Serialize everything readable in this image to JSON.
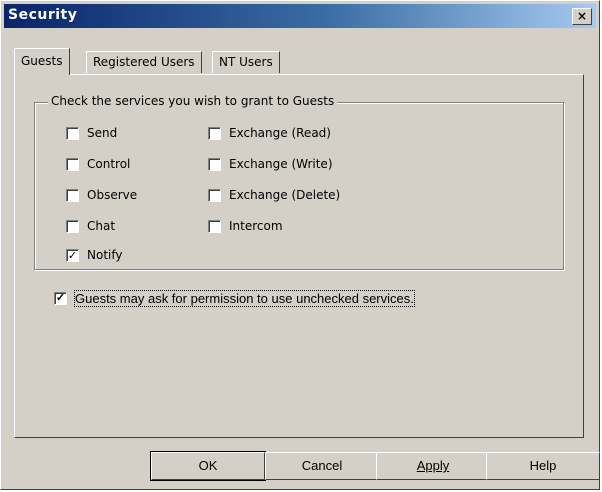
{
  "window": {
    "title": "Security",
    "close_glyph": "×"
  },
  "tabs": [
    {
      "label": "Guests"
    },
    {
      "label": "Registered Users"
    },
    {
      "label": "NT Users"
    }
  ],
  "group": {
    "legend": "Check the services you wish to grant to Guests"
  },
  "services": {
    "left": [
      {
        "label": "Send",
        "checked": false
      },
      {
        "label": "Control",
        "checked": false
      },
      {
        "label": "Observe",
        "checked": false
      },
      {
        "label": "Chat",
        "checked": false
      },
      {
        "label": "Notify",
        "checked": true
      }
    ],
    "right": [
      {
        "label": "Exchange (Read)",
        "checked": false
      },
      {
        "label": "Exchange (Write)",
        "checked": false
      },
      {
        "label": "Exchange (Delete)",
        "checked": false
      },
      {
        "label": "Intercom",
        "checked": false
      }
    ]
  },
  "permission": {
    "label": "Guests may ask for permission to use unchecked services.",
    "checked": true
  },
  "buttons": {
    "ok": "OK",
    "cancel": "Cancel",
    "apply": "Apply",
    "help": "Help"
  },
  "check_mark": "✓"
}
